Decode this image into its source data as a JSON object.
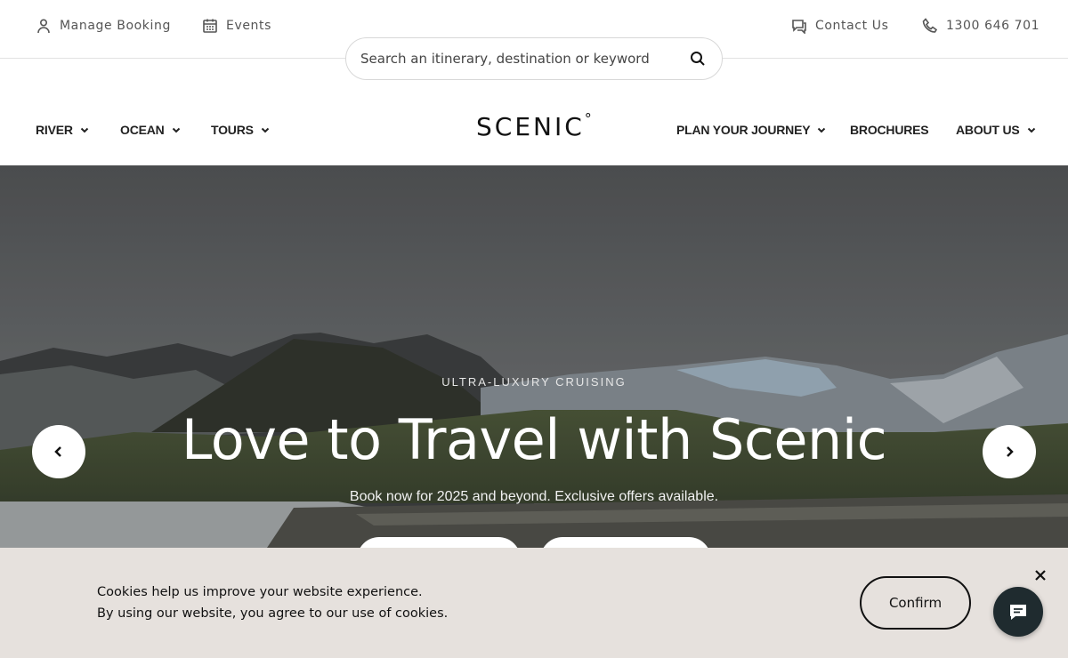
{
  "utility": {
    "manage_booking": "Manage Booking",
    "events": "Events",
    "contact_us": "Contact Us",
    "phone": "1300 646 701"
  },
  "search": {
    "placeholder": "Search an itinerary, destination or keyword"
  },
  "nav": {
    "logo": "SCENIC",
    "logo_mark": "°",
    "left": [
      {
        "label": "RIVER"
      },
      {
        "label": "OCEAN"
      },
      {
        "label": "TOURS"
      }
    ],
    "right": [
      {
        "label": "PLAN YOUR JOURNEY"
      },
      {
        "label": "BROCHURES"
      },
      {
        "label": "ABOUT US"
      }
    ]
  },
  "hero": {
    "eyebrow": "ULTRA-LUXURY CRUISING",
    "headline": "Love to Travel with Scenic",
    "subtext": "Book now for 2025 and beyond. Exclusive offers available."
  },
  "cookie": {
    "line1": "Cookies help us improve your website experience.",
    "line2": "By using our website, you agree to our use of cookies.",
    "confirm": "Confirm"
  },
  "icons": {
    "manage_booking": "user-icon",
    "events": "calendar-icon",
    "contact_us": "chat-bubble-icon",
    "phone": "phone-icon",
    "search": "search-icon",
    "chat_widget": "chat-icon",
    "close": "close-icon"
  },
  "colors": {
    "cookie_bg": "#e6e1dd",
    "chat_bg": "#1f2b2f",
    "text": "#222222"
  }
}
